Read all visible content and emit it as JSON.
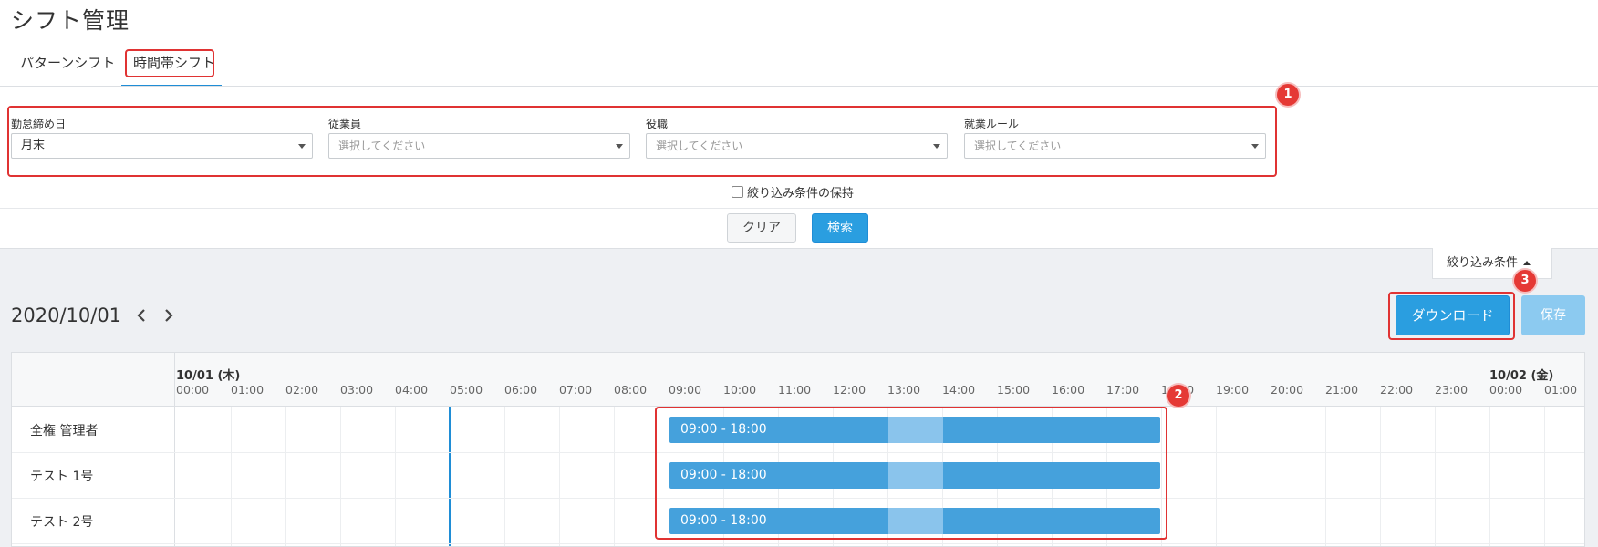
{
  "title": "シフト管理",
  "tabs": [
    {
      "label": "パターンシフト"
    },
    {
      "label": "時間帯シフト"
    }
  ],
  "filters": [
    {
      "label": "勤怠締め日",
      "value": "月末",
      "placeholder": ""
    },
    {
      "label": "従業員",
      "value": "",
      "placeholder": "選択してください"
    },
    {
      "label": "役職",
      "value": "",
      "placeholder": "選択してください"
    },
    {
      "label": "就業ルール",
      "value": "",
      "placeholder": "選択してください"
    }
  ],
  "keep_conditions_label": "絞り込み条件の保持",
  "buttons": {
    "clear": "クリア",
    "search": "検索",
    "download": "ダウンロード",
    "save": "保存"
  },
  "filter_toggle_label": "絞り込み条件",
  "current_date": "2020/10/01",
  "timeline": {
    "day1": "10/01 (木)",
    "day2": "10/02 (金)",
    "hours": [
      "00:00",
      "01:00",
      "02:00",
      "03:00",
      "04:00",
      "05:00",
      "06:00",
      "07:00",
      "08:00",
      "09:00",
      "10:00",
      "11:00",
      "12:00",
      "13:00",
      "14:00",
      "15:00",
      "16:00",
      "17:00",
      "18:00",
      "19:00",
      "20:00",
      "21:00",
      "22:00",
      "23:00",
      "00:00",
      "01:00"
    ]
  },
  "employees": [
    {
      "name": "全権 管理者",
      "shift": "09:00 - 18:00"
    },
    {
      "name": "テスト 1号",
      "shift": "09:00 - 18:00"
    },
    {
      "name": "テスト 2号",
      "shift": "09:00 - 18:00"
    }
  ],
  "shift_hours": {
    "start": 9,
    "end": 18,
    "break_start": 13,
    "break_end": 14
  },
  "current_time_hour": 5,
  "callouts": [
    "1",
    "2",
    "3"
  ],
  "colors": {
    "primary": "#2a9ee0",
    "shift_bar": "#45a1dc",
    "shift_break": "#8ac4ec",
    "callout": "#e03333"
  }
}
